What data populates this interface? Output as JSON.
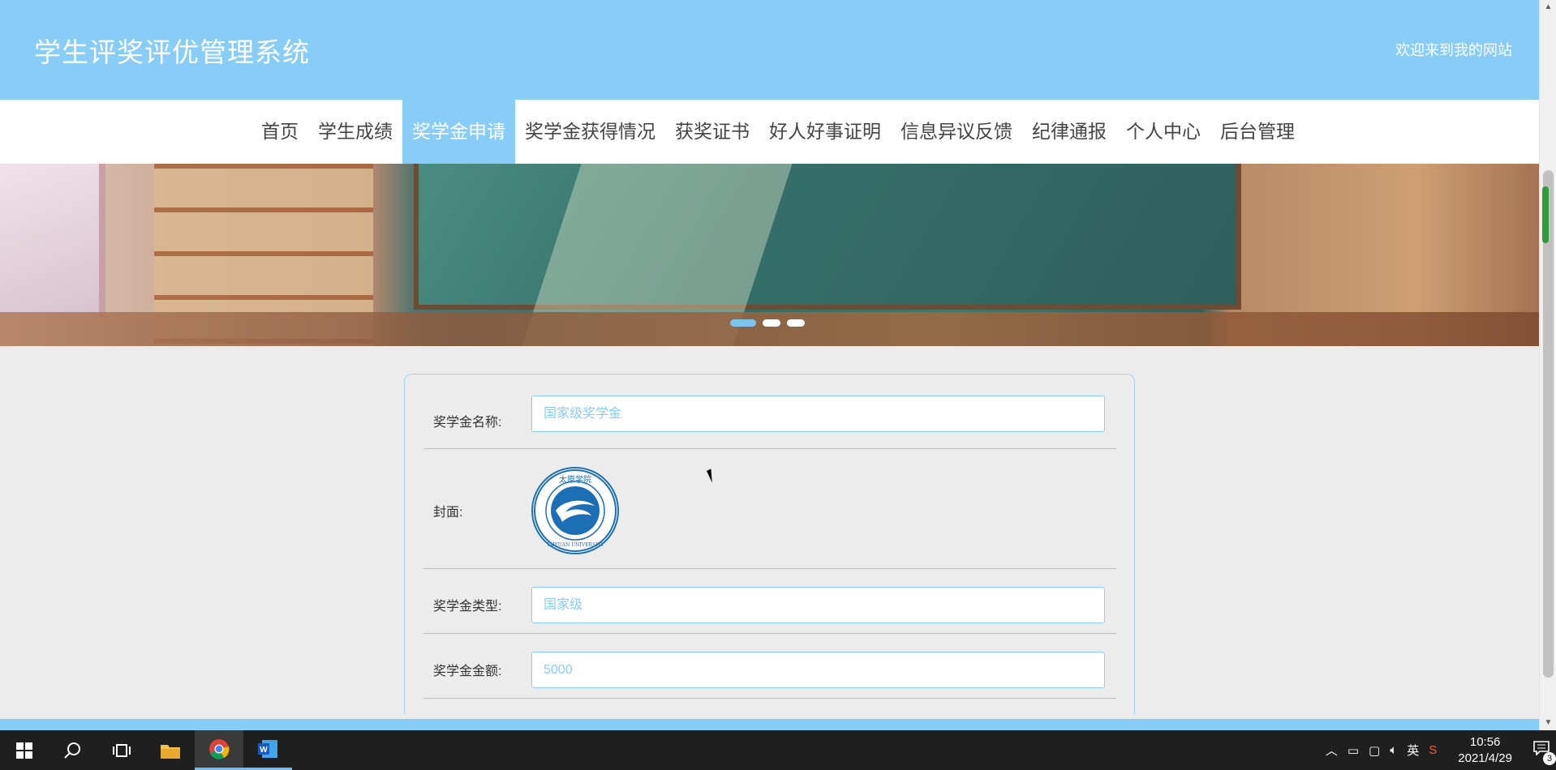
{
  "header": {
    "site_title": "学生评奖评优管理系统",
    "welcome": "欢迎来到我的网站"
  },
  "nav": {
    "items": [
      {
        "label": "首页"
      },
      {
        "label": "学生成绩"
      },
      {
        "label": "奖学金申请",
        "active": true
      },
      {
        "label": "奖学金获得情况"
      },
      {
        "label": "获奖证书"
      },
      {
        "label": "好人好事证明"
      },
      {
        "label": "信息异议反馈"
      },
      {
        "label": "纪律通报"
      },
      {
        "label": "个人中心"
      },
      {
        "label": "后台管理"
      }
    ]
  },
  "banner": {
    "slide_count": 3,
    "active_slide": 1
  },
  "form": {
    "name_label": "奖学金名称:",
    "name_value": "国家级奖学金",
    "cover_label": "封面:",
    "cover_logo_text_top": "太原学院",
    "cover_logo_text_bottom": "TAIYUAN UNIVERSITY",
    "type_label": "奖学金类型:",
    "type_value": "国家级",
    "amount_label": "奖学金金额:",
    "amount_value": "5000"
  },
  "taskbar": {
    "apps": [
      "start-icon",
      "search-icon",
      "task-view-icon",
      "file-explorer-icon",
      "chrome-icon",
      "word-icon"
    ],
    "tray": {
      "ime": "英",
      "time": "10:56",
      "date": "2021/4/29",
      "notification_count": "3"
    }
  },
  "colors": {
    "primary": "#87cdf7",
    "taskbar": "#1f1f1f",
    "background": "#ececec"
  }
}
